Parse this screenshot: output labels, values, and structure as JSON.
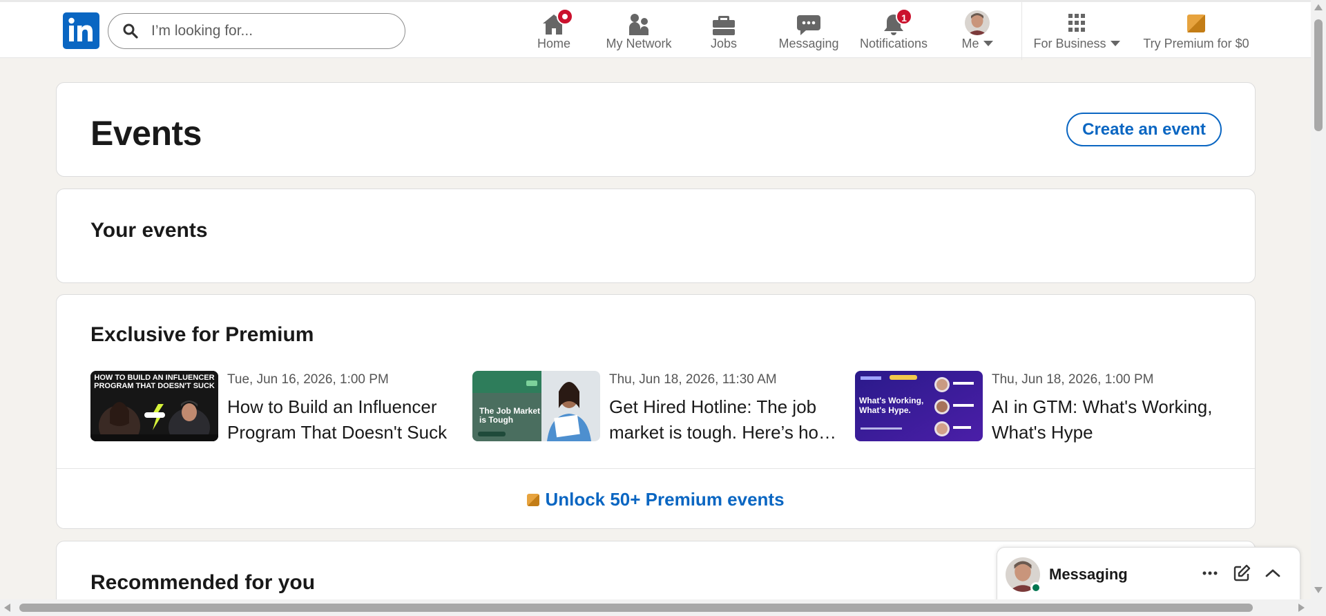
{
  "nav": {
    "search_placeholder": "I’m looking for...",
    "items": [
      {
        "label": "Home",
        "icon": "home-icon",
        "badge": "dot"
      },
      {
        "label": "My Network",
        "icon": "people-icon"
      },
      {
        "label": "Jobs",
        "icon": "briefcase-icon"
      },
      {
        "label": "Messaging",
        "icon": "chat-icon"
      },
      {
        "label": "Notifications",
        "icon": "bell-icon",
        "badge": "1"
      },
      {
        "label": "Me",
        "icon": "avatar"
      },
      {
        "label": "For Business",
        "icon": "grid-icon"
      },
      {
        "label": "Try Premium for $0",
        "icon": "premium-icon"
      }
    ],
    "notifications_badge": "1"
  },
  "events_header": {
    "title": "Events",
    "create_button": "Create an event"
  },
  "your_events": {
    "title": "Your events"
  },
  "premium": {
    "title": "Exclusive for Premium",
    "events": [
      {
        "date": "Tue, Jun 16, 2026, 1:00 PM",
        "title": "How to Build an Influencer Program That Doesn't Suck",
        "thumb_text": "HOW TO BUILD AN INFLUENCER PROGRAM THAT DOESN'T SUCK"
      },
      {
        "date": "Thu, Jun 18, 2026, 11:30 AM",
        "title": "Get Hired Hotline: The job market is tough. Here’s how you can stand out",
        "thumb_text": "The Job Market is Tough"
      },
      {
        "date": "Thu, Jun 18, 2026, 1:00 PM",
        "title": "AI in GTM: What's Working, What's Hype",
        "thumb_text": "What's Working, What's Hype."
      }
    ],
    "unlock_label": "Unlock 50+ Premium events"
  },
  "recommended": {
    "title": "Recommended for you"
  },
  "messaging": {
    "title": "Messaging"
  },
  "colors": {
    "brand": "#0a66c2",
    "badge": "#cb112d",
    "premium_gold": "#e7a33e",
    "online": "#01754f"
  }
}
